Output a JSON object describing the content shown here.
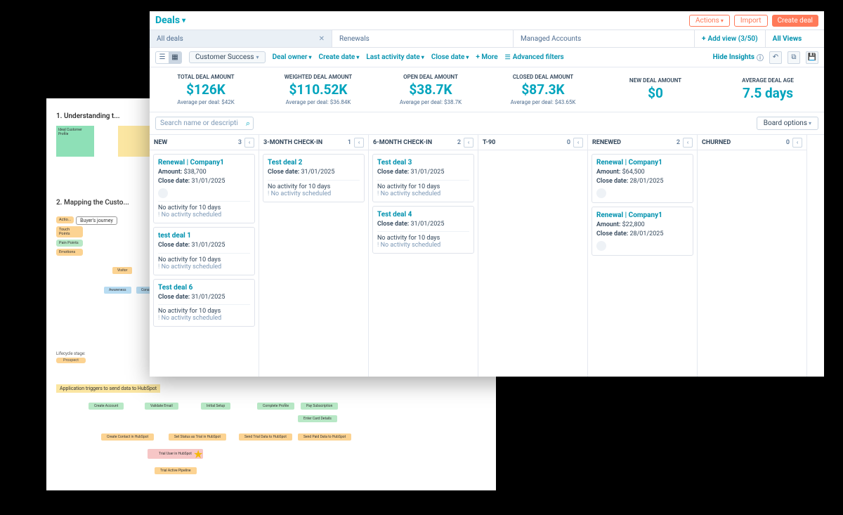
{
  "bgdoc": {
    "h1": "1. Understanding t...",
    "h2": "2. Mapping the Custo...",
    "sidelabels": {
      "act": "Actio...",
      "buyer": "Buyer's journey"
    },
    "lifecycle": "Lifecycle stage:",
    "triggerlabel": "Application triggers to send data to HubSpot"
  },
  "deals": {
    "title": "Deals",
    "buttons": {
      "actions": "Actions",
      "import": "Import",
      "create": "Create deal"
    },
    "tabs": {
      "t1": "All deals",
      "t2": "Renewals",
      "t3": "Managed Accounts",
      "addview": "Add view (3/50)",
      "allviews": "All Views"
    },
    "filters": {
      "pipeline": "Customer Success",
      "owner": "Deal owner",
      "create": "Create date",
      "last": "Last activity date",
      "close": "Close date",
      "more": "More",
      "adv": "Advanced filters",
      "hide": "Hide Insights"
    },
    "insights": [
      {
        "label": "TOTAL DEAL AMOUNT",
        "value": "$126K",
        "sub": "Average per deal: $42K"
      },
      {
        "label": "WEIGHTED DEAL AMOUNT",
        "value": "$110.52K",
        "sub": "Average per deal: $36.84K"
      },
      {
        "label": "OPEN DEAL AMOUNT",
        "value": "$38.7K",
        "sub": "Average per deal: $38.7K"
      },
      {
        "label": "CLOSED DEAL AMOUNT",
        "value": "$87.3K",
        "sub": "Average per deal: $43.65K"
      },
      {
        "label": "NEW DEAL AMOUNT",
        "value": "$0",
        "sub": ""
      },
      {
        "label": "AVERAGE DEAL AGE",
        "value": "7.5 days",
        "sub": ""
      }
    ],
    "search_placeholder": "Search name or descriptio",
    "board_options": "Board options",
    "columns": [
      {
        "name": "NEW",
        "count": "3",
        "cards": [
          {
            "title": "Renewal | Company1",
            "lines": [
              "Amount: $38,700",
              "Close date: 31/01/2025"
            ],
            "activity": "No activity for 10 days",
            "sched": "No activity scheduled",
            "avatar": true
          },
          {
            "title": "test deal 1",
            "lines": [
              "Close date: 31/01/2025"
            ],
            "activity": "No activity for 10 days",
            "sched": "No activity scheduled"
          },
          {
            "title": "Test deal 6",
            "lines": [
              "Close date: 31/01/2025"
            ],
            "activity": "No activity for 10 days",
            "sched": "No activity scheduled"
          }
        ]
      },
      {
        "name": "3-MONTH CHECK-IN",
        "count": "1",
        "cards": [
          {
            "title": "Test deal 2",
            "lines": [
              "Close date: 31/01/2025"
            ],
            "activity": "No activity for 10 days",
            "sched": "No activity scheduled"
          }
        ]
      },
      {
        "name": "6-MONTH CHECK-IN",
        "count": "2",
        "cards": [
          {
            "title": "Test deal 3",
            "lines": [
              "Close date: 31/01/2025"
            ],
            "activity": "No activity for 10 days",
            "sched": "No activity scheduled"
          },
          {
            "title": "Test deal 4",
            "lines": [
              "Close date: 31/01/2025"
            ],
            "activity": "No activity for 10 days",
            "sched": "No activity scheduled"
          }
        ]
      },
      {
        "name": "T-90",
        "count": "0",
        "cards": []
      },
      {
        "name": "RENEWED",
        "count": "2",
        "cards": [
          {
            "title": "Renewal | Company1",
            "lines": [
              "Amount: $64,500",
              "Close date: 28/01/2025"
            ],
            "avatar": true
          },
          {
            "title": "Renewal | Company1",
            "lines": [
              "Amount: $22,800",
              "Close date: 28/01/2025"
            ],
            "avatar": true
          }
        ]
      },
      {
        "name": "CHURNED",
        "count": "0",
        "cards": []
      }
    ]
  }
}
